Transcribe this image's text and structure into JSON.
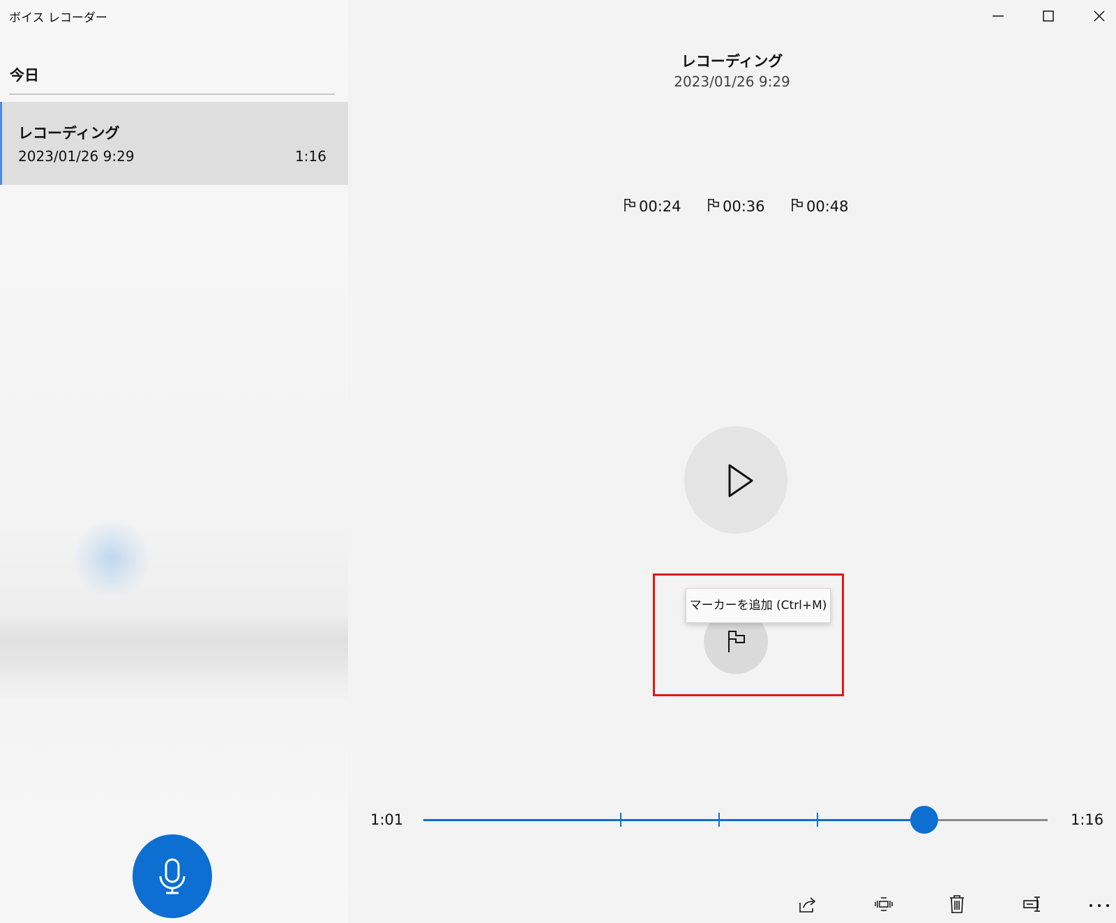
{
  "app": {
    "title": "ボイス レコーダー"
  },
  "window_controls": {
    "minimize_icon": "minimize-icon",
    "maximize_icon": "maximize-icon",
    "close_icon": "close-icon"
  },
  "sidebar": {
    "section_title": "今日",
    "recordings": [
      {
        "name": "レコーディング",
        "date": "2023/01/26 9:29",
        "duration": "1:16",
        "selected": true
      }
    ],
    "record_button_icon": "microphone-icon"
  },
  "detail": {
    "title": "レコーディング",
    "date": "2023/01/26 9:29",
    "markers": [
      {
        "icon": "flag-icon",
        "time": "00:24"
      },
      {
        "icon": "flag-icon",
        "time": "00:36"
      },
      {
        "icon": "flag-icon",
        "time": "00:48"
      }
    ],
    "play_icon": "play-icon",
    "add_marker_icon": "flag-icon",
    "tooltip": "マーカーを追加 (Ctrl+M)"
  },
  "playback": {
    "current_time": "1:01",
    "total_time": "1:16",
    "progress_fraction": 0.8026,
    "marker_seconds": [
      24,
      36,
      48
    ],
    "total_seconds": 76
  },
  "toolbar": {
    "icons": [
      "share-icon",
      "trim-icon",
      "delete-icon",
      "rename-icon",
      "more-icon"
    ],
    "more_label": "..."
  },
  "colors": {
    "accent": "#0d6fd1",
    "highlight_box": "#e01818",
    "selected_item": "#dedede"
  }
}
